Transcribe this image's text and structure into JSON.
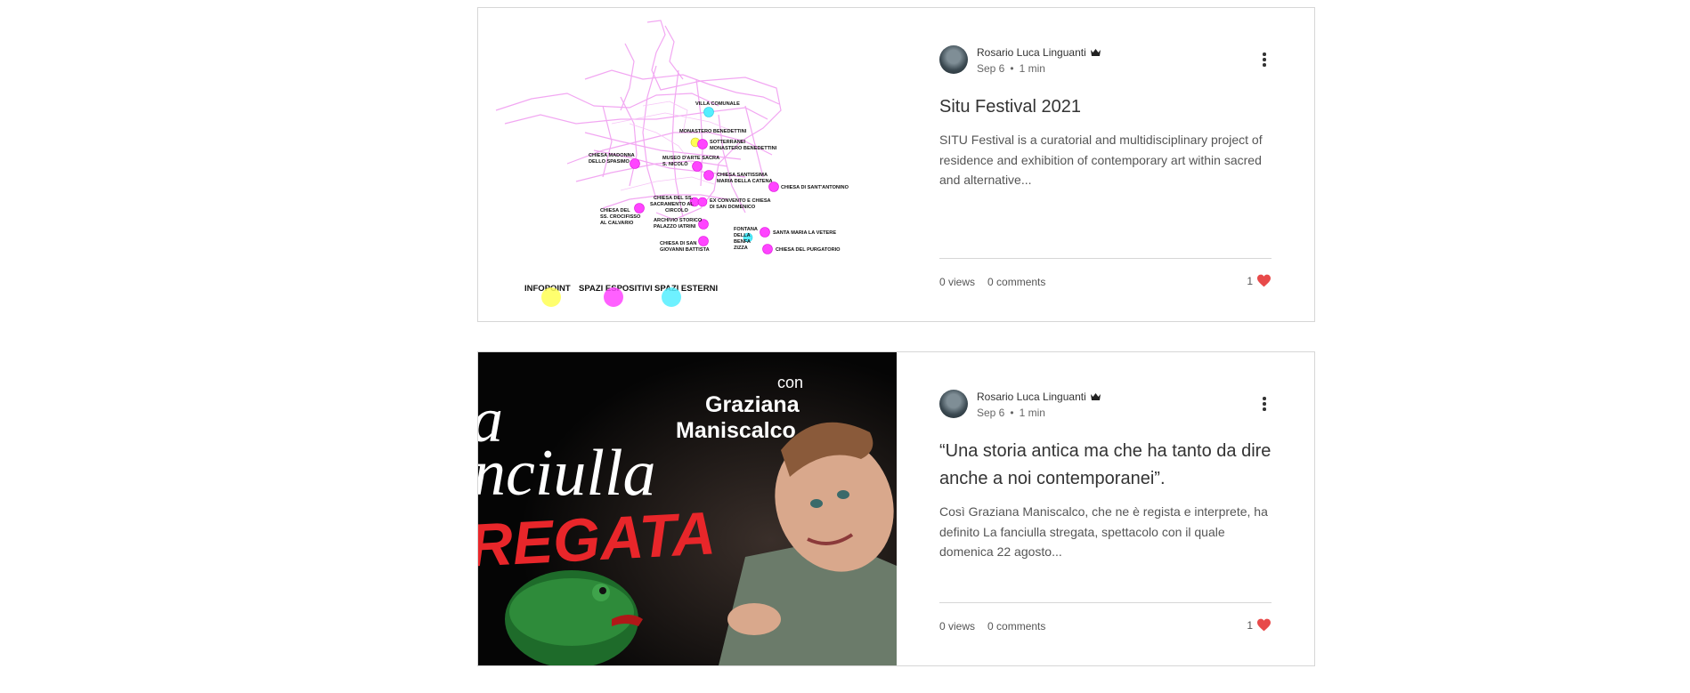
{
  "posts": [
    {
      "author": "Rosario Luca Linguanti",
      "date": "Sep 6",
      "read_time": "1 min",
      "title": "Situ Festival 2021",
      "excerpt": "SITU Festival is a curatorial and multidisciplinary project of residence and exhibition of contemporary art within sacred and alternative...",
      "views": "0 views",
      "comments": "0 comments",
      "likes": "1",
      "image": {
        "kind": "map",
        "labels": {
          "villa": "VILLA COMUNALE",
          "monastero": "MONASTERO BENEDETTINI",
          "sotterranei_1": "SOTTERRANEI",
          "sotterranei_2": "MONASTERO BENEDETTINI",
          "madonna_1": "CHIESA MADONNA",
          "madonna_2": "DELLO SPASIMO",
          "museo_1": "MUSEO D'ARTE SACRA",
          "museo_2": "S. NICOLÒ",
          "santissima_1": "CHIESA SANTISSIMA",
          "santissima_2": "MARIA DELLA CATENA",
          "antonino": "CHIESA DI SANT'ANTONINO",
          "sacramento_1": "CHIESA DEL SS.",
          "sacramento_2": "SACRAMENTO AL",
          "sacramento_3": "CIRCOLO",
          "convento_1": "EX CONVENTO E CHIESA",
          "convento_2": "DI SAN DOMENICO",
          "crocifisso_1": "CHIESA DEL",
          "crocifisso_2": "SS. CROCIFISSO",
          "crocifisso_3": "AL CALVARIO",
          "archivio_1": "ARCHIVIO STORICO",
          "archivio_2": "PALAZZO IATRINI",
          "fontana_1": "FONTANA",
          "fontana_2": "DELLA",
          "fontana_3": "BENFA",
          "fontana_4": "ZIZZA",
          "vetere": "SANTA MARIA LA VETERE",
          "giovanni_1": "CHIESA DI SAN",
          "giovanni_2": "GIOVANNI BATTISTA",
          "purgatorio": "CHIESA DEL PURGATORIO",
          "legend_infopoint": "INFOPOINT",
          "legend_espositivi": "SPAZI ESPOSITIVI",
          "legend_esterni": "SPAZI ESTERNI"
        },
        "colors": {
          "infopoint": "#ffff55",
          "espositivi": "#ff44ff",
          "esterni": "#55eeff",
          "streets": "#f2a7f2"
        }
      }
    },
    {
      "author": "Rosario Luca Linguanti",
      "date": "Sep 6",
      "read_time": "1 min",
      "title": "“Una storia antica ma che ha tanto da dire anche a noi contemporanei”.",
      "excerpt": "Così Graziana Maniscalco, che ne è regista e interprete, ha definito La fanciulla stregata, spettacolo con il quale domenica 22 agosto...",
      "views": "0 views",
      "comments": "0 comments",
      "likes": "1",
      "image": {
        "kind": "poster",
        "con": "con",
        "name_1": "Graziana",
        "name_2": "Maniscalco",
        "title_1": "a",
        "title_2": "nciulla",
        "title_3": "REGATA"
      }
    }
  ],
  "icons": {
    "crown": "crown-icon",
    "more": "more-vertical-icon",
    "heart": "heart-icon"
  },
  "colors": {
    "heart": "#e84a4a",
    "border": "#d6d6d6"
  }
}
